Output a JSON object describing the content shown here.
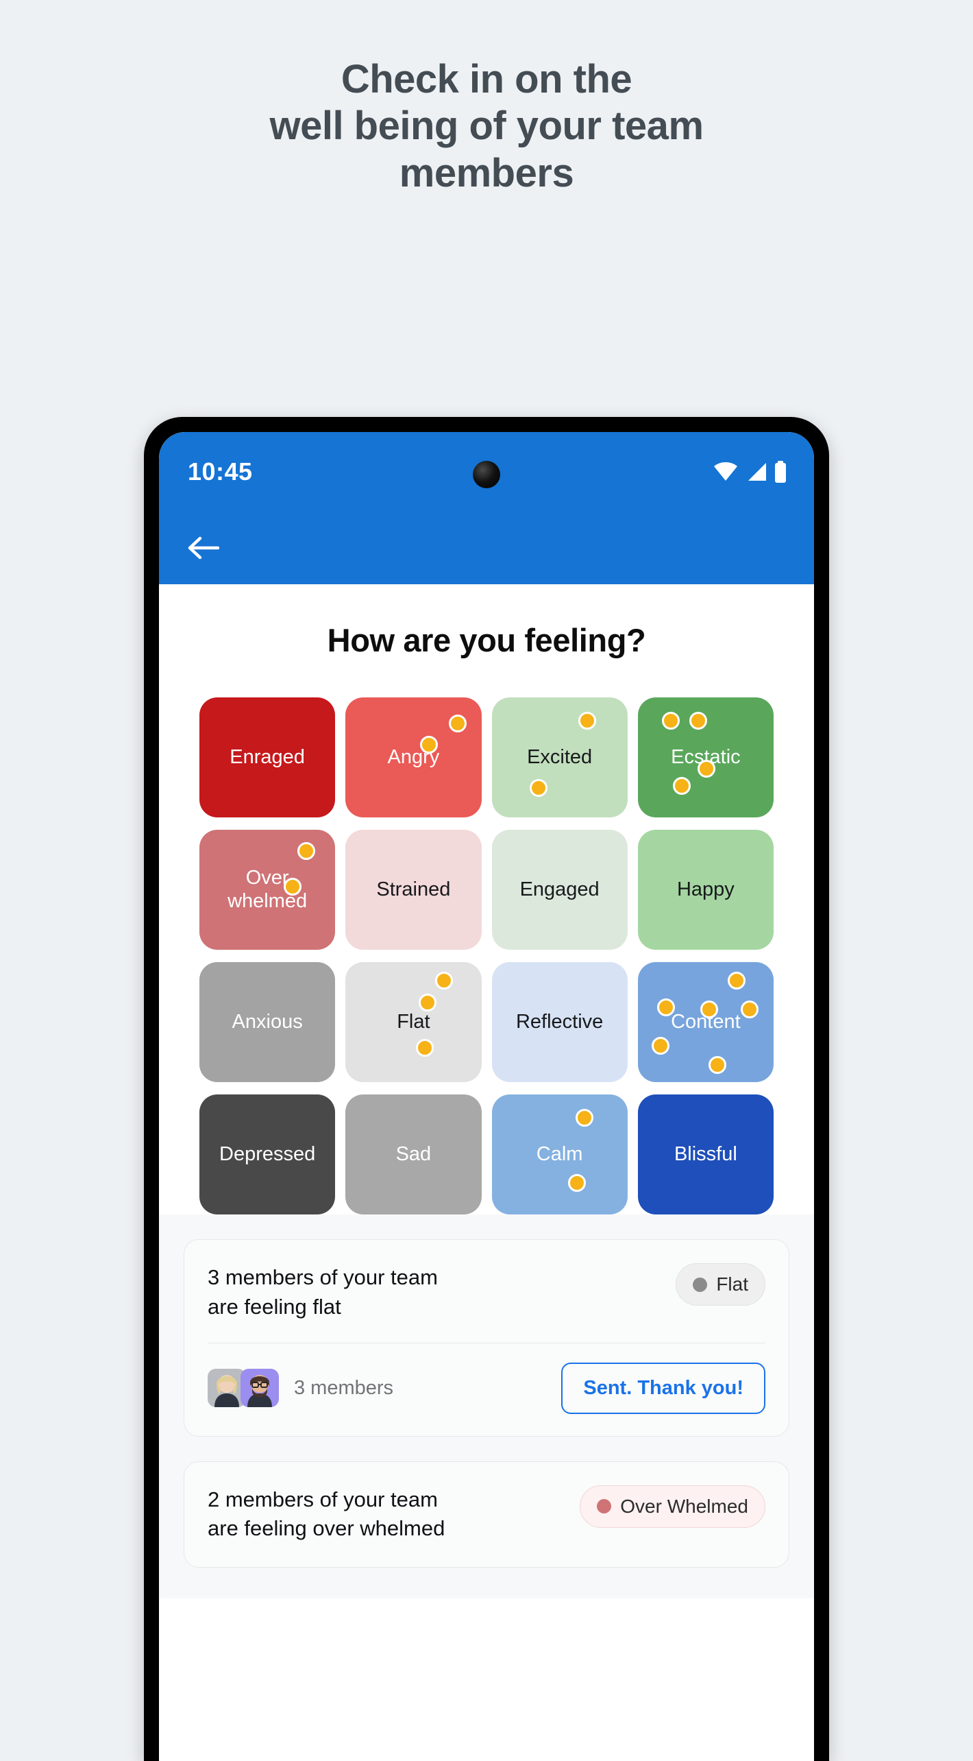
{
  "headline": {
    "line1": "Check in on the",
    "line2": "well being of your team",
    "line3": "members"
  },
  "phone": {
    "status": {
      "time": "10:45",
      "wifi_icon": "wifi-icon",
      "signal_icon": "cellular-signal-icon",
      "battery_icon": "battery-icon",
      "camera_icon": "front-camera-icon"
    },
    "appbar": {
      "back_icon": "back-arrow-icon",
      "bg_color": "#1574d4"
    }
  },
  "screen": {
    "title": "How are you feeling?",
    "dot_color": "#f6b216",
    "moods": [
      {
        "label": "Enraged",
        "color": "#c5191c",
        "text_color": "#ffffff",
        "dots": []
      },
      {
        "label": "Angry",
        "color": "#ea5a56",
        "text_color": "#ffffff",
        "dots": [
          [
            55,
            32
          ],
          [
            76,
            14
          ]
        ]
      },
      {
        "label": "Excited",
        "color": "#c2dfbd",
        "text_color": "#17191c",
        "dots": [
          [
            64,
            12
          ],
          [
            28,
            68
          ]
        ]
      },
      {
        "label": "Ecstatic",
        "color": "#5aa75b",
        "text_color": "#ffffff",
        "dots": [
          [
            18,
            12
          ],
          [
            38,
            12
          ],
          [
            44,
            52
          ],
          [
            26,
            66
          ]
        ]
      },
      {
        "label": "Over whelmed",
        "color": "#cf7376",
        "text_color": "#ffffff",
        "dots": [
          [
            72,
            10
          ],
          [
            62,
            40
          ]
        ]
      },
      {
        "label": "Strained",
        "color": "#f2d9da",
        "text_color": "#17191c",
        "dots": []
      },
      {
        "label": "Engaged",
        "color": "#dde8dc",
        "text_color": "#17191c",
        "dots": []
      },
      {
        "label": "Happy",
        "color": "#a5d6a1",
        "text_color": "#17191c",
        "dots": []
      },
      {
        "label": "Anxious",
        "color": "#a3a3a3",
        "text_color": "#ffffff",
        "dots": []
      },
      {
        "label": "Flat",
        "color": "#e2e2e2",
        "text_color": "#17191c",
        "dots": [
          [
            66,
            8
          ],
          [
            54,
            26
          ],
          [
            52,
            64
          ]
        ]
      },
      {
        "label": "Reflective",
        "color": "#d7e3f4",
        "text_color": "#17191c",
        "dots": []
      },
      {
        "label": "Content",
        "color": "#77a4dc",
        "text_color": "#ffffff",
        "dots": [
          [
            66,
            8
          ],
          [
            14,
            30
          ],
          [
            46,
            32
          ],
          [
            76,
            32
          ],
          [
            10,
            62
          ],
          [
            52,
            78
          ]
        ]
      },
      {
        "label": "Depressed",
        "color": "#49494a",
        "text_color": "#ffffff",
        "dots": []
      },
      {
        "label": "Sad",
        "color": "#a8a8a8",
        "text_color": "#ffffff",
        "dots": []
      },
      {
        "label": "Calm",
        "color": "#85b1e0",
        "text_color": "#ffffff",
        "dots": [
          [
            62,
            12
          ],
          [
            56,
            66
          ]
        ]
      },
      {
        "label": "Blissful",
        "color": "#1e4fba",
        "text_color": "#ffffff",
        "dots": []
      }
    ],
    "cards": [
      {
        "text_line1": "3 members of your team",
        "text_line2": "are feeling flat",
        "chip_label": "Flat",
        "chip_style": "chip-flat",
        "chip_dot_color": "#8b8b8b",
        "members_count": "3 members",
        "button_label": "Sent. Thank you!",
        "has_footer": true
      },
      {
        "text_line1": "2 members of your team",
        "text_line2": "are feeling over whelmed",
        "chip_label": "Over Whelmed",
        "chip_style": "chip-ow",
        "chip_dot_color": "#cf7376",
        "has_footer": false
      }
    ]
  }
}
